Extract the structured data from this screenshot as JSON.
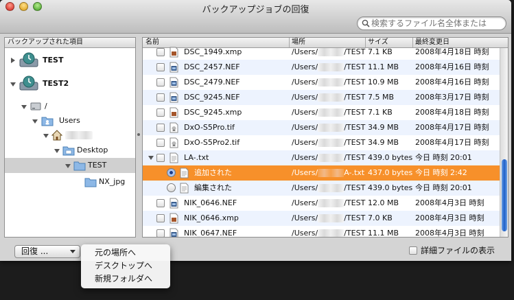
{
  "window": {
    "title": "バックアップジョブの回復"
  },
  "search": {
    "placeholder": "検索するファイル名全体または"
  },
  "sidebar": {
    "header": "バックアップされた項目",
    "items": [
      {
        "label": "TEST"
      },
      {
        "label": "TEST2"
      },
      {
        "label": "/"
      },
      {
        "label": "Users"
      },
      {
        "label": ""
      },
      {
        "label": "Desktop"
      },
      {
        "label": "TEST"
      },
      {
        "label": "NX_jpg"
      }
    ]
  },
  "files": {
    "columns": [
      "名前",
      "場所",
      "サイズ",
      "最終変更日"
    ],
    "rows": [
      {
        "name": "DSC_1949.xmp",
        "loc_a": "/Users/",
        "loc_b": "/TEST",
        "size": "7.1 KB",
        "date": "2008年4月18日 時刻"
      },
      {
        "name": "DSC_2457.NEF",
        "loc_a": "/Users/",
        "loc_b": "/TEST",
        "size": "11.1 MB",
        "date": "2008年4月16日 時刻"
      },
      {
        "name": "DSC_2479.NEF",
        "loc_a": "/Users/",
        "loc_b": "/TEST",
        "size": "10.9 MB",
        "date": "2008年4月16日 時刻"
      },
      {
        "name": "DSC_9245.NEF",
        "loc_a": "/Users/",
        "loc_b": "/TEST",
        "size": "7.5 MB",
        "date": "2008年3月17日 時刻"
      },
      {
        "name": "DSC_9245.xmp",
        "loc_a": "/Users/",
        "loc_b": "/TEST",
        "size": "7.1 KB",
        "date": "2008年4月18日 時刻"
      },
      {
        "name": "DxO-S5Pro.tif",
        "loc_a": "/Users/",
        "loc_b": "/TEST",
        "size": "34.9 MB",
        "date": "2008年4月17日 時刻"
      },
      {
        "name": "DxO-S5Pro2.tif",
        "loc_a": "/Users/",
        "loc_b": "/TEST",
        "size": "34.9 MB",
        "date": "2008年4月17日 時刻"
      },
      {
        "name": "LA-.txt",
        "loc_a": "/Users/",
        "loc_b": "/TEST",
        "size": "439.0 bytes",
        "date": "今日 時刻 20:01"
      },
      {
        "name": "追加された",
        "loc_a": "/Users/",
        "loc_b": "A-.txt",
        "size": "437.0 bytes",
        "date": "今日 時刻 2:42"
      },
      {
        "name": "編集された",
        "loc_a": "/Users/",
        "loc_b": "/TEST",
        "size": "439.0 bytes",
        "date": "今日 時刻 20:01"
      },
      {
        "name": "NIK_0646.NEF",
        "loc_a": "/Users/",
        "loc_b": "/TEST",
        "size": "12.0 MB",
        "date": "2008年4月3日 時刻"
      },
      {
        "name": "NIK_0646.xmp",
        "loc_a": "/Users/",
        "loc_b": "/TEST",
        "size": "7.0 KB",
        "date": "2008年4月3日 時刻"
      },
      {
        "name": "NIK_0647.NEF",
        "loc_a": "/Users/",
        "loc_b": "/TEST",
        "size": "11.1 MB",
        "date": "2008年4月3日 時刻"
      }
    ]
  },
  "restore_button": {
    "label": "回復 ..."
  },
  "restore_menu": {
    "items": [
      "元の場所へ",
      "デスクトップへ",
      "新規フォルダへ"
    ]
  },
  "detail_toggle": {
    "label": "詳細ファイルの表示",
    "checked": false
  },
  "colors": {
    "selection": "#f7902a",
    "alt_row": "#edf3fe",
    "scroll_thumb": "#1f5fc8"
  }
}
